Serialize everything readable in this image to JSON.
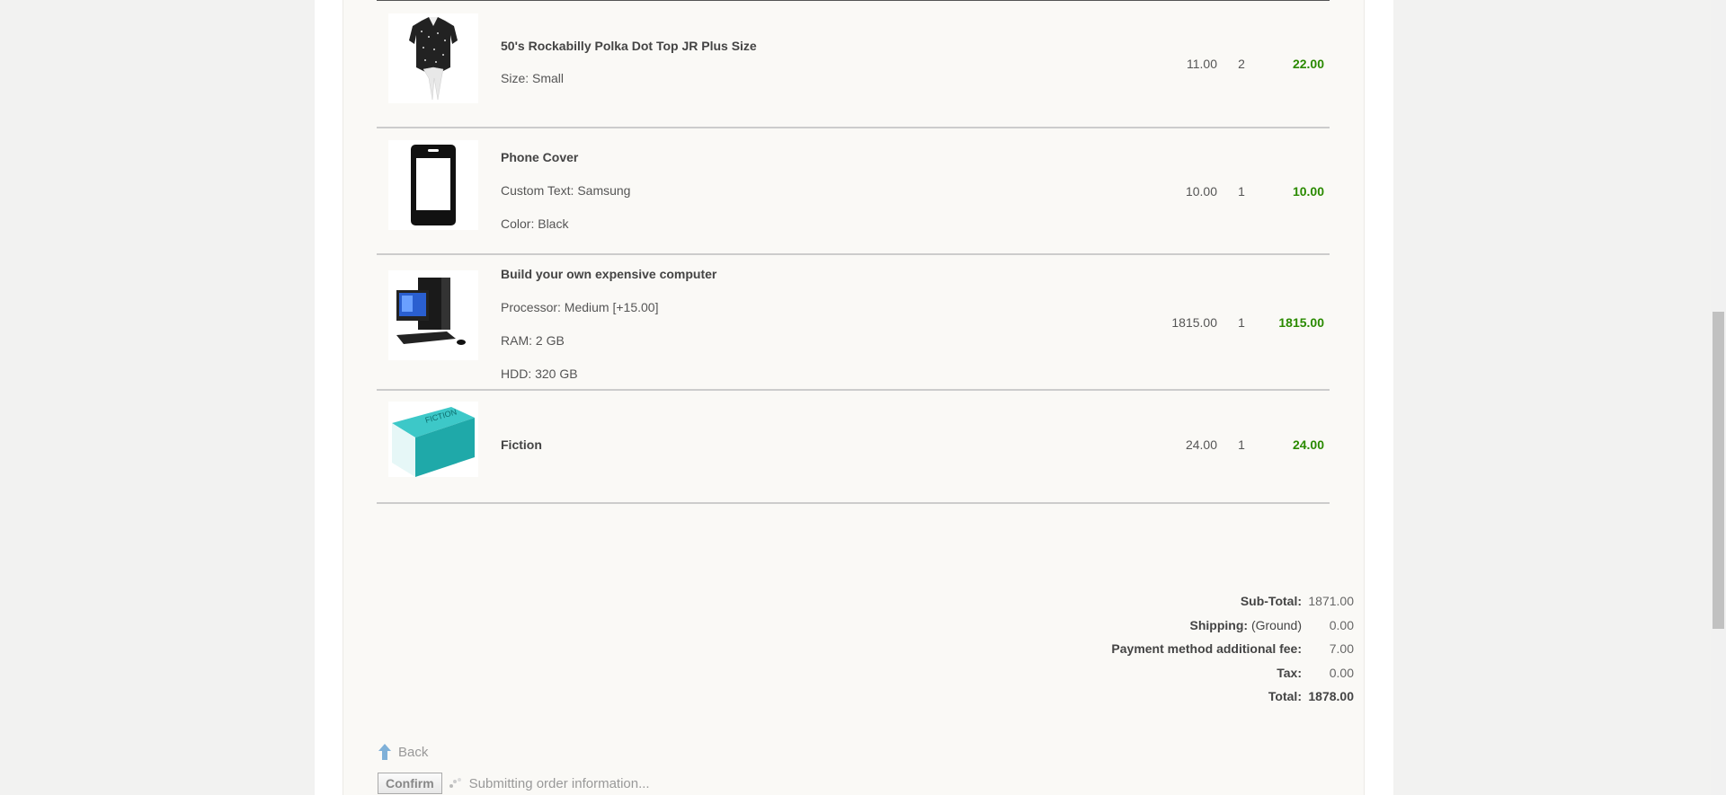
{
  "cart": {
    "items": [
      {
        "name": "50's Rockabilly Polka Dot Top JR Plus Size",
        "attributes": [
          "Size: Small"
        ],
        "unit_price": "11.00",
        "qty": "2",
        "total": "22.00",
        "image_icon": "polka-dot-top-image"
      },
      {
        "name": "Phone Cover",
        "attributes": [
          "Custom Text: Samsung",
          "Color: Black"
        ],
        "unit_price": "10.00",
        "qty": "1",
        "total": "10.00",
        "image_icon": "phone-cover-image"
      },
      {
        "name": "Build your own expensive computer",
        "attributes": [
          "Processor: Medium [+15.00]",
          "RAM: 2 GB",
          "HDD: 320 GB"
        ],
        "unit_price": "1815.00",
        "qty": "1",
        "total": "1815.00",
        "image_icon": "computer-image"
      },
      {
        "name": "Fiction",
        "attributes": [],
        "unit_price": "24.00",
        "qty": "1",
        "total": "24.00",
        "image_icon": "fiction-book-image"
      }
    ]
  },
  "totals": {
    "subtotal_label": "Sub-Total:",
    "subtotal_value": "1871.00",
    "shipping_label": "Shipping:",
    "shipping_method": "(Ground)",
    "shipping_value": "0.00",
    "payment_fee_label": "Payment method additional fee:",
    "payment_fee_value": "7.00",
    "tax_label": "Tax:",
    "tax_value": "0.00",
    "total_label": "Total:",
    "total_value": "1878.00"
  },
  "actions": {
    "back_label": "Back",
    "confirm_label": "Confirm",
    "submitting_text": "Submitting order information..."
  },
  "colors": {
    "line_total": "#2a8a00",
    "content_bg": "#faf9f6",
    "page_bg": "#f2f2f1"
  }
}
